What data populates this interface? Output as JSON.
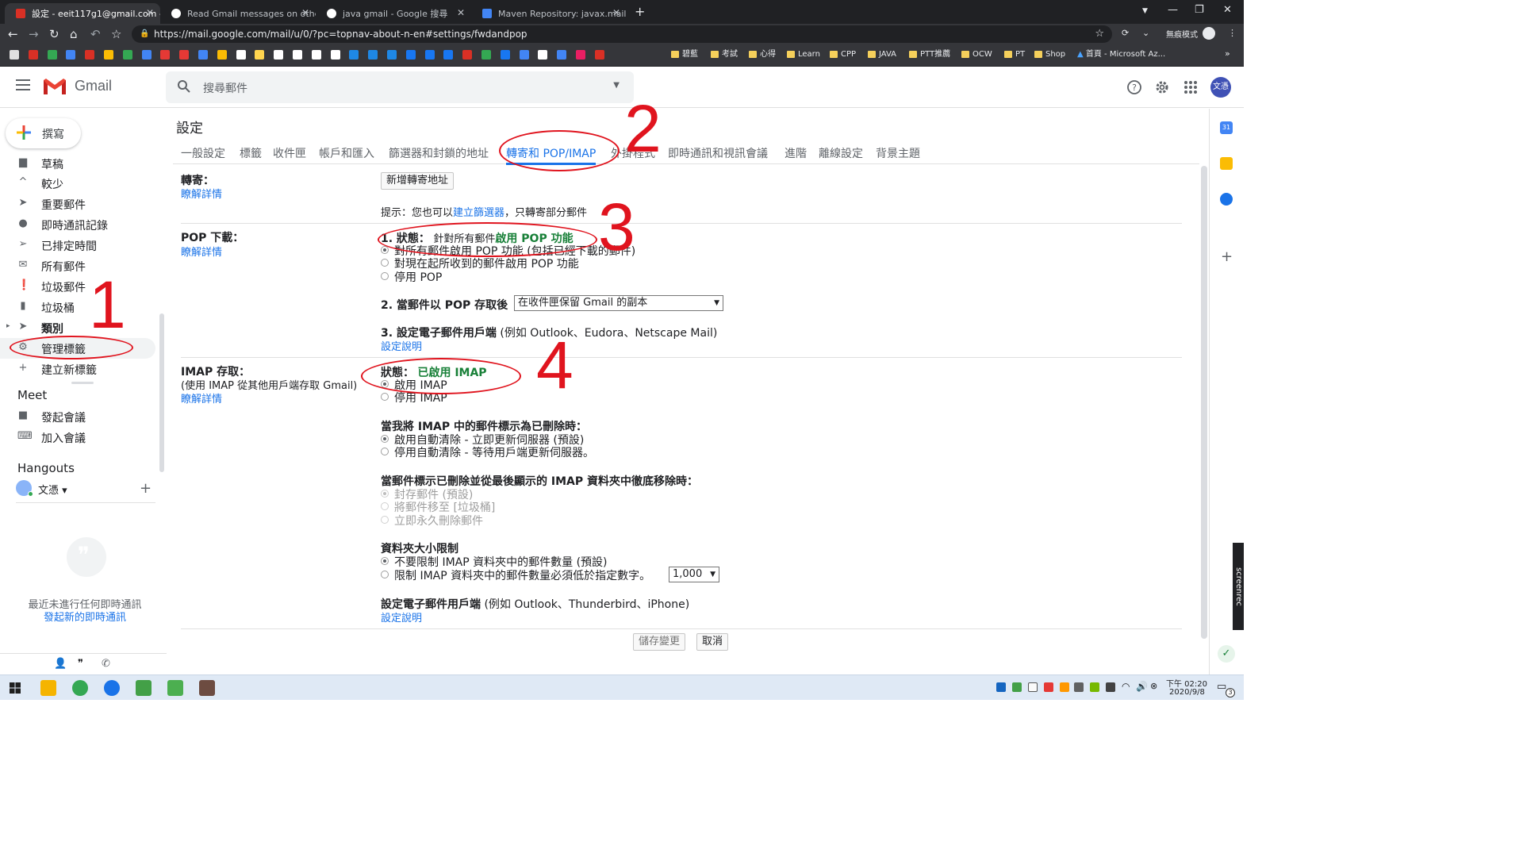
{
  "browser": {
    "tabs": [
      {
        "title": "設定 - eeit117g1@gmail.com -",
        "active": true,
        "favicon_color": "#d93025"
      },
      {
        "title": "Read Gmail messages on other",
        "active": false,
        "favicon_color": "#ffffff"
      },
      {
        "title": "java gmail - Google 搜尋",
        "active": false,
        "favicon_color": "#ffffff"
      },
      {
        "title": "Maven Repository: javax.mail »",
        "active": false,
        "favicon_color": "#4285f4"
      }
    ],
    "new_tab": "+",
    "url": "https://mail.google.com/mail/u/0/?pc=topnav-about-n-en#settings/fwdandpop",
    "incognito_label": "無痕模式",
    "bookmark_folders": [
      "碧藍",
      "考試",
      "心得",
      "Learn",
      "CPP",
      "JAVA",
      "PTT推薦",
      "OCW",
      "PT",
      "Shop"
    ],
    "bookmark_last": "首頁 - Microsoft Az...",
    "bookmark_icon_colors": [
      "#e0e0e0",
      "#d93025",
      "#34a853",
      "#4285f4",
      "#d93025",
      "#fbbc04",
      "#34a853",
      "#4285f4",
      "#e53935",
      "#e53935",
      "#4285f4",
      "#fbbc04",
      "#ffffff",
      "#ffd54f",
      "#ffffff",
      "#ffffff",
      "#ffffff",
      "#ffffff",
      "#1e88e5",
      "#1e88e5",
      "#1e88e5",
      "#1877f2",
      "#1877f2",
      "#1877f2",
      "#d93025",
      "#34a853",
      "#1877f2",
      "#4285f4",
      "#ffffff",
      "#4285f4",
      "#e91e63",
      "#d93025"
    ]
  },
  "gmail": {
    "product_name": "Gmail",
    "search_placeholder": "搜尋郵件",
    "avatar_text": "文憑",
    "compose_label": "撰寫",
    "nav": [
      {
        "label": "草稿",
        "icon": "draft-icon"
      },
      {
        "label": "較少",
        "icon": "chevron-up-icon"
      },
      {
        "label": "重要郵件",
        "icon": "important-icon"
      },
      {
        "label": "即時通訊記錄",
        "icon": "chat-icon"
      },
      {
        "label": "已排定時間",
        "icon": "scheduled-icon"
      },
      {
        "label": "所有郵件",
        "icon": "all-mail-icon"
      },
      {
        "label": "垃圾郵件",
        "icon": "spam-icon"
      },
      {
        "label": "垃圾桶",
        "icon": "trash-icon"
      },
      {
        "label": "類別",
        "icon": "label-icon"
      },
      {
        "label": "管理標籤",
        "icon": "gear-icon"
      },
      {
        "label": "建立新標籤",
        "icon": "plus-icon"
      }
    ],
    "meet_title": "Meet",
    "meet_items": [
      "發起會議",
      "加入會議"
    ],
    "hangouts_title": "Hangouts",
    "hangouts_user": "文憑",
    "hangouts_empty": "最近未進行任何即時通訊",
    "hangouts_start": "發起新的即時通訊"
  },
  "settings": {
    "title": "設定",
    "tabs": [
      "一般設定",
      "標籤",
      "收件匣",
      "帳戶和匯入",
      "篩選器和封鎖的地址",
      "轉寄和 POP/IMAP",
      "外掛程式",
      "即時通訊和視訊會議",
      "進階",
      "離線設定",
      "背景主題"
    ],
    "active_tab": "轉寄和 POP/IMAP",
    "learn_more": "瞭解詳情",
    "forwarding": {
      "label": "轉寄：",
      "add_button": "新增轉寄地址",
      "tip_prefix": "提示：您也可以",
      "tip_link": "建立篩選器",
      "tip_suffix": "，只轉寄部分郵件"
    },
    "pop": {
      "label": "POP 下載：",
      "status_prefix": "1. 狀態：",
      "status_text": "針對所有郵件",
      "status_value": "啟用 POP 功能",
      "options": [
        "對所有郵件啟用 POP 功能 (包括已經下載的郵件)",
        "對現在起所收到的郵件啟用 POP 功能",
        "停用 POP"
      ],
      "selected": 0,
      "q2": "2. 當郵件以 POP 存取後",
      "q2_value": "在收件匣保留 Gmail 的副本",
      "q3": "3. 設定電子郵件用戶端",
      "q3_example": "(例如 Outlook、Eudora、Netscape Mail)",
      "setup_link": "設定說明"
    },
    "imap": {
      "label": "IMAP 存取：",
      "sub": "(使用 IMAP 從其他用戶端存取 Gmail)",
      "status_prefix": "狀態：",
      "status_value": "已啟用 IMAP",
      "options": [
        "啟用 IMAP",
        "停用 IMAP"
      ],
      "delete_title": "當我將 IMAP 中的郵件標示為已刪除時：",
      "delete_options": [
        "啟用自動清除 - 立即更新伺服器 (預設)",
        "停用自動清除 - 等待用戶端更新伺服器。"
      ],
      "expunge_title": "當郵件標示已刪除並從最後顯示的 IMAP 資料夾中徹底移除時：",
      "expunge_options": [
        "封存郵件 (預設)",
        "將郵件移至 [垃圾桶]",
        "立即永久刪除郵件"
      ],
      "folder_title": "資料夾大小限制",
      "folder_options": [
        "不要限制 IMAP 資料夾中的郵件數量 (預設)",
        "限制 IMAP 資料夾中的郵件數量必須低於指定數字。"
      ],
      "folder_limit": "1,000",
      "client_title": "設定電子郵件用戶端",
      "client_example": "(例如 Outlook、Thunderbird、iPhone)",
      "setup_link": "設定說明"
    },
    "save_button": "儲存變更",
    "cancel_button": "取消"
  },
  "annotations": [
    "1",
    "2",
    "3",
    "4"
  ],
  "sidebar_brand": "screenrec",
  "taskbar": {
    "time": "下午 02:20",
    "date": "2020/9/8",
    "notifications": "3",
    "app_colors": [
      "#f5b400",
      "#34a853",
      "#1a73e8",
      "#43a047",
      "#4caf50",
      "#6d4c41"
    ]
  }
}
